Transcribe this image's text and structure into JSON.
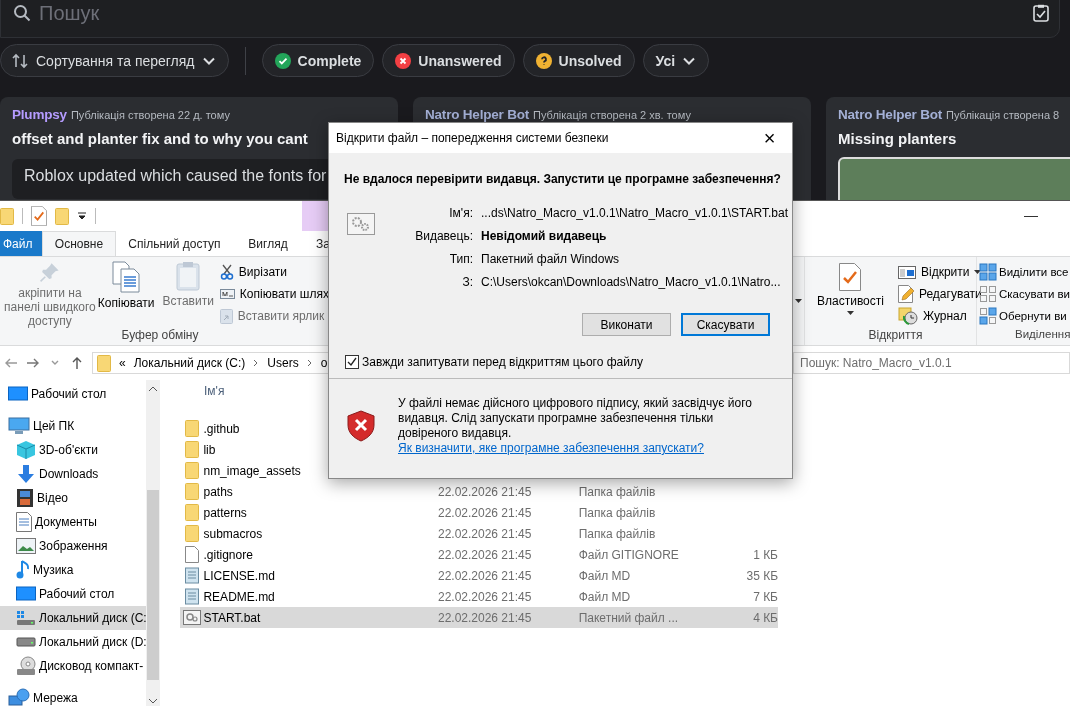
{
  "forum": {
    "search": {
      "placeholder": "Пошук"
    },
    "sort_button": "Сортування та перегляд",
    "tags": [
      {
        "label": "Complete",
        "kind": "check",
        "color": "#23a55a"
      },
      {
        "label": "Unanswered",
        "kind": "cross",
        "color": "#f23f43"
      },
      {
        "label": "Unsolved",
        "kind": "question",
        "color": "#f0b232"
      }
    ],
    "filter_dropdown": "Усі",
    "posts": [
      {
        "author": "Plumpsy",
        "color": "#b59cff",
        "time": "Публікація створена 22 д. тому",
        "title": "offset and planter fix and to why you cant",
        "kind": "text",
        "preview": "Roblox updated which caused the fonts for"
      },
      {
        "author": "Natro Helper Bot",
        "color": "#a4b0d6",
        "time": "Публікація створена 2 хв. тому",
        "kind": "text"
      },
      {
        "author": "Natro Helper Bot",
        "color": "#a4b0d6",
        "time": "Публікація створена 8",
        "title": "Missing planters",
        "kind": "image"
      }
    ]
  },
  "explorer": {
    "tabs": [
      {
        "label": "Файл",
        "kind": "file",
        "selected": false
      },
      {
        "label": "Основне",
        "kind": "tab",
        "selected": true
      },
      {
        "label": "Спільний доступ",
        "kind": "tab",
        "selected": false
      },
      {
        "label": "Вигляд",
        "kind": "tab",
        "selected": false
      },
      {
        "label": "За",
        "kind": "tab",
        "selected": false
      }
    ],
    "ribbon": {
      "clipboard": {
        "large": [
          {
            "label": "акріпити на панелі швидкого доступу",
            "kind": "pin",
            "disabled": true
          },
          {
            "label": "Копіювати",
            "kind": "copy",
            "disabled": false
          },
          {
            "label": "Вставити",
            "kind": "paste",
            "disabled": true
          }
        ],
        "small": [
          {
            "label": "Вирізати",
            "kind": "cut",
            "disabled": false
          },
          {
            "label": "Копіювати шлях",
            "kind": "copypath",
            "disabled": false
          },
          {
            "label": "Вставити ярлик",
            "kind": "shortcut",
            "disabled": true
          }
        ],
        "label": "Буфер обміну"
      },
      "open": {
        "large": {
          "label": "Властивості",
          "kind": "properties"
        },
        "small": [
          {
            "label": "Відкрити",
            "kind": "open",
            "dropdown": true
          },
          {
            "label": "Редагувати",
            "kind": "edit",
            "dropdown": false
          },
          {
            "label": "Журнал",
            "kind": "history",
            "dropdown": false
          }
        ],
        "label": "Відкриття"
      },
      "select": {
        "small": [
          {
            "label": "Виділити все",
            "kind": "all"
          },
          {
            "label": "Скасувати ви",
            "kind": "none"
          },
          {
            "label": "Обернути ви",
            "kind": "invert"
          }
        ],
        "label": "Виділення"
      }
    },
    "address": {
      "overflow": "«",
      "crumbs": [
        "Локальний диск (C:)",
        "Users",
        "o"
      ]
    },
    "search": {
      "placeholder": "Пошук: Natro_Macro_v1.0.1"
    },
    "nav": [
      {
        "label": "Рабочий стол",
        "kind": "desktop",
        "selected": false
      },
      {
        "label": "Цей ПК",
        "kind": "pc",
        "selected": false,
        "children": [
          {
            "label": "3D-об'єкти",
            "kind": "objects",
            "selected": false
          },
          {
            "label": "Downloads",
            "kind": "downloads",
            "selected": false
          },
          {
            "label": "Відео",
            "kind": "video",
            "selected": false
          },
          {
            "label": "Документы",
            "kind": "documents",
            "selected": false
          },
          {
            "label": "Зображення",
            "kind": "pictures",
            "selected": false
          },
          {
            "label": "Музика",
            "kind": "music",
            "selected": false
          },
          {
            "label": "Рабочий стол",
            "kind": "desktop",
            "selected": false
          },
          {
            "label": "Локальний диск (C:",
            "kind": "systemdrive",
            "selected": true
          },
          {
            "label": "Локальний диск (D:",
            "kind": "drive",
            "selected": false
          },
          {
            "label": "Дисковод компакт-",
            "kind": "cdrom",
            "selected": false
          }
        ]
      },
      {
        "label": "Мережа",
        "kind": "network",
        "selected": false
      }
    ],
    "columns": [
      "Ім'я"
    ],
    "files": [
      {
        "name": ".github",
        "kind": "folder",
        "selected": false
      },
      {
        "name": "lib",
        "kind": "folder",
        "selected": false
      },
      {
        "name": "nm_image_assets",
        "kind": "folder",
        "selected": false
      },
      {
        "name": "paths",
        "kind": "folder",
        "date": "22.02.2026 21:45",
        "type": "Папка файлів",
        "selected": false
      },
      {
        "name": "patterns",
        "kind": "folder",
        "date": "22.02.2026 21:45",
        "type": "Папка файлів",
        "selected": false
      },
      {
        "name": "submacros",
        "kind": "folder",
        "date": "22.02.2026 21:45",
        "type": "Папка файлів",
        "selected": false
      },
      {
        "name": ".gitignore",
        "kind": "file",
        "date": "22.02.2026 21:45",
        "type": "Файл GITIGNORE",
        "size": "1 КБ",
        "selected": false
      },
      {
        "name": "LICENSE.md",
        "kind": "text",
        "date": "22.02.2026 21:45",
        "type": "Файл MD",
        "size": "35 КБ",
        "selected": false
      },
      {
        "name": "README.md",
        "kind": "text",
        "date": "22.02.2026 21:45",
        "type": "Файл MD",
        "size": "7 КБ",
        "selected": false
      },
      {
        "name": "START.bat",
        "kind": "batch",
        "date": "22.02.2026 21:45",
        "type": "Пакетний файл ...",
        "size": "4 КБ",
        "selected": true
      }
    ]
  },
  "dialog": {
    "title": "Відкрити файл – попередження системи безпеки",
    "close": "×",
    "heading": "Не вдалося перевірити видавця.  Запустити це програмне забезпечення?",
    "fields": [
      {
        "label": "Ім'я:",
        "value": "...ds\\Natro_Macro_v1.0.1\\Natro_Macro_v1.0.1\\START.bat",
        "bold": false
      },
      {
        "label": "Видавець:",
        "value": "Невідомий видавець",
        "bold": true
      },
      {
        "label": "Тип:",
        "value": "Пакетний файл Windows",
        "bold": false
      },
      {
        "label": "З:",
        "value": "C:\\Users\\okcan\\Downloads\\Natro_Macro_v1.0.1\\Natro...",
        "bold": false
      }
    ],
    "buttons": [
      {
        "label": "Виконати",
        "default": false
      },
      {
        "label": "Скасувати",
        "default": true
      }
    ],
    "checkbox": {
      "label": "Завжди запитувати перед відкриттям цього файлу",
      "checked": true
    },
    "warning": "У файлі немає дійсного цифрового підпису, який засвідчує його видавця.  Слід запускати програмне забезпечення тільки довіреного видавця.",
    "link": "Як визначити, яке програмне забезпечення запускати?"
  }
}
